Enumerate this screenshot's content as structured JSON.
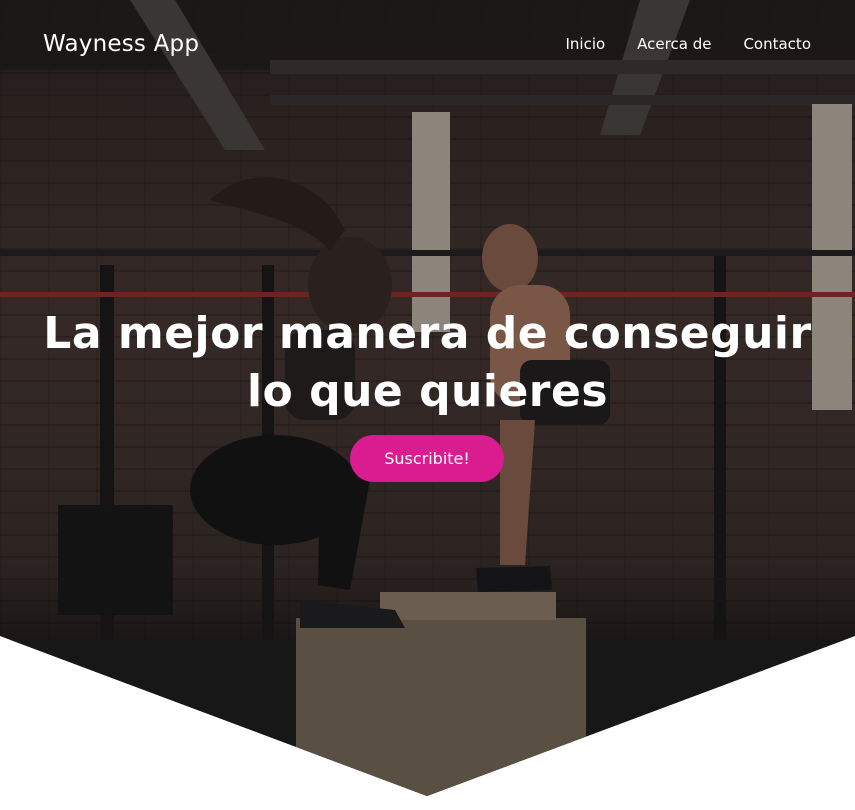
{
  "navbar": {
    "brand": "Wayness App",
    "links": [
      {
        "label": "Inicio"
      },
      {
        "label": "Acerca de"
      },
      {
        "label": "Contacto"
      }
    ]
  },
  "hero": {
    "title_line_1": "La mejor manera de conseguir",
    "title_line_2": "lo que quieres",
    "cta_label": "Suscribite!",
    "background_image": "gym-box-jump-photo"
  },
  "colors": {
    "accent": "#d91c8f",
    "text": "#ffffff",
    "page_background": "#ffffff"
  }
}
